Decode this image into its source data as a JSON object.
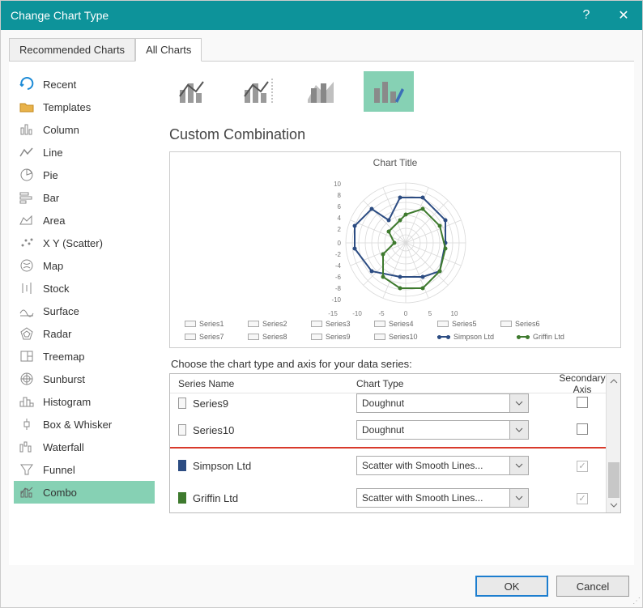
{
  "dialog": {
    "title": "Change Chart Type",
    "help": "?",
    "close": "✕"
  },
  "tabs": {
    "rec": "Recommended Charts",
    "all": "All Charts"
  },
  "sidebar": {
    "items": [
      {
        "label": "Recent"
      },
      {
        "label": "Templates"
      },
      {
        "label": "Column"
      },
      {
        "label": "Line"
      },
      {
        "label": "Pie"
      },
      {
        "label": "Bar"
      },
      {
        "label": "Area"
      },
      {
        "label": "X Y (Scatter)"
      },
      {
        "label": "Map"
      },
      {
        "label": "Stock"
      },
      {
        "label": "Surface"
      },
      {
        "label": "Radar"
      },
      {
        "label": "Treemap"
      },
      {
        "label": "Sunburst"
      },
      {
        "label": "Histogram"
      },
      {
        "label": "Box & Whisker"
      },
      {
        "label": "Waterfall"
      },
      {
        "label": "Funnel"
      },
      {
        "label": "Combo"
      }
    ]
  },
  "section": {
    "title": "Custom Combination"
  },
  "preview": {
    "title": "Chart Title",
    "legend_series": [
      "Series1",
      "Series2",
      "Series3",
      "Series4",
      "Series5",
      "Series6",
      "Series7",
      "Series8",
      "Series9",
      "Series10"
    ],
    "legend_lines": [
      {
        "label": "Simpson Ltd",
        "color": "#2c4c82"
      },
      {
        "label": "Griffin Ltd",
        "color": "#3e7a2e"
      }
    ]
  },
  "grid": {
    "instr": "Choose the chart type and axis for your data series:",
    "head": {
      "name": "Series Name",
      "type": "Chart Type",
      "axis": "Secondary Axis"
    },
    "rows": [
      {
        "name": "Series9",
        "type": "Doughnut",
        "axis": false,
        "sw": ""
      },
      {
        "name": "Series10",
        "type": "Doughnut",
        "axis": false,
        "sw": ""
      },
      {
        "name": "Simpson Ltd",
        "type": "Scatter with Smooth Lines...",
        "axis": true,
        "sw": "blue"
      },
      {
        "name": "Griffin Ltd",
        "type": "Scatter with Smooth Lines...",
        "axis": true,
        "sw": "green"
      }
    ]
  },
  "footer": {
    "ok": "OK",
    "cancel": "Cancel"
  },
  "chart_data": {
    "type": "radar",
    "title": "Chart Title",
    "y_ticks": [
      -10,
      -8,
      -6,
      -4,
      -2,
      0,
      2,
      4,
      6,
      8,
      10
    ],
    "x_ticks": [
      -15,
      -10,
      -5,
      0,
      5,
      10
    ],
    "series": [
      {
        "name": "Simpson Ltd",
        "color": "#2c4c82",
        "points": [
          [
            -1,
            8
          ],
          [
            3,
            8
          ],
          [
            7,
            4
          ],
          [
            7,
            0
          ],
          [
            6,
            -5
          ],
          [
            3,
            -6
          ],
          [
            -1,
            -6
          ],
          [
            -6,
            -5
          ],
          [
            -9,
            -1
          ],
          [
            -9,
            3
          ],
          [
            -6,
            6
          ],
          [
            -3,
            4
          ],
          [
            -1,
            8
          ]
        ]
      },
      {
        "name": "Griffin Ltd",
        "color": "#3e7a2e",
        "points": [
          [
            0,
            5
          ],
          [
            3,
            6
          ],
          [
            6,
            3
          ],
          [
            7,
            -1
          ],
          [
            6,
            -5
          ],
          [
            3,
            -8
          ],
          [
            -1,
            -8
          ],
          [
            -4,
            -6
          ],
          [
            -4,
            -2
          ],
          [
            -2,
            0
          ],
          [
            -3,
            2
          ],
          [
            -1,
            4
          ],
          [
            0,
            5
          ]
        ]
      }
    ],
    "legend_doughnut": [
      "Series1",
      "Series2",
      "Series3",
      "Series4",
      "Series5",
      "Series6",
      "Series7",
      "Series8",
      "Series9",
      "Series10"
    ]
  }
}
